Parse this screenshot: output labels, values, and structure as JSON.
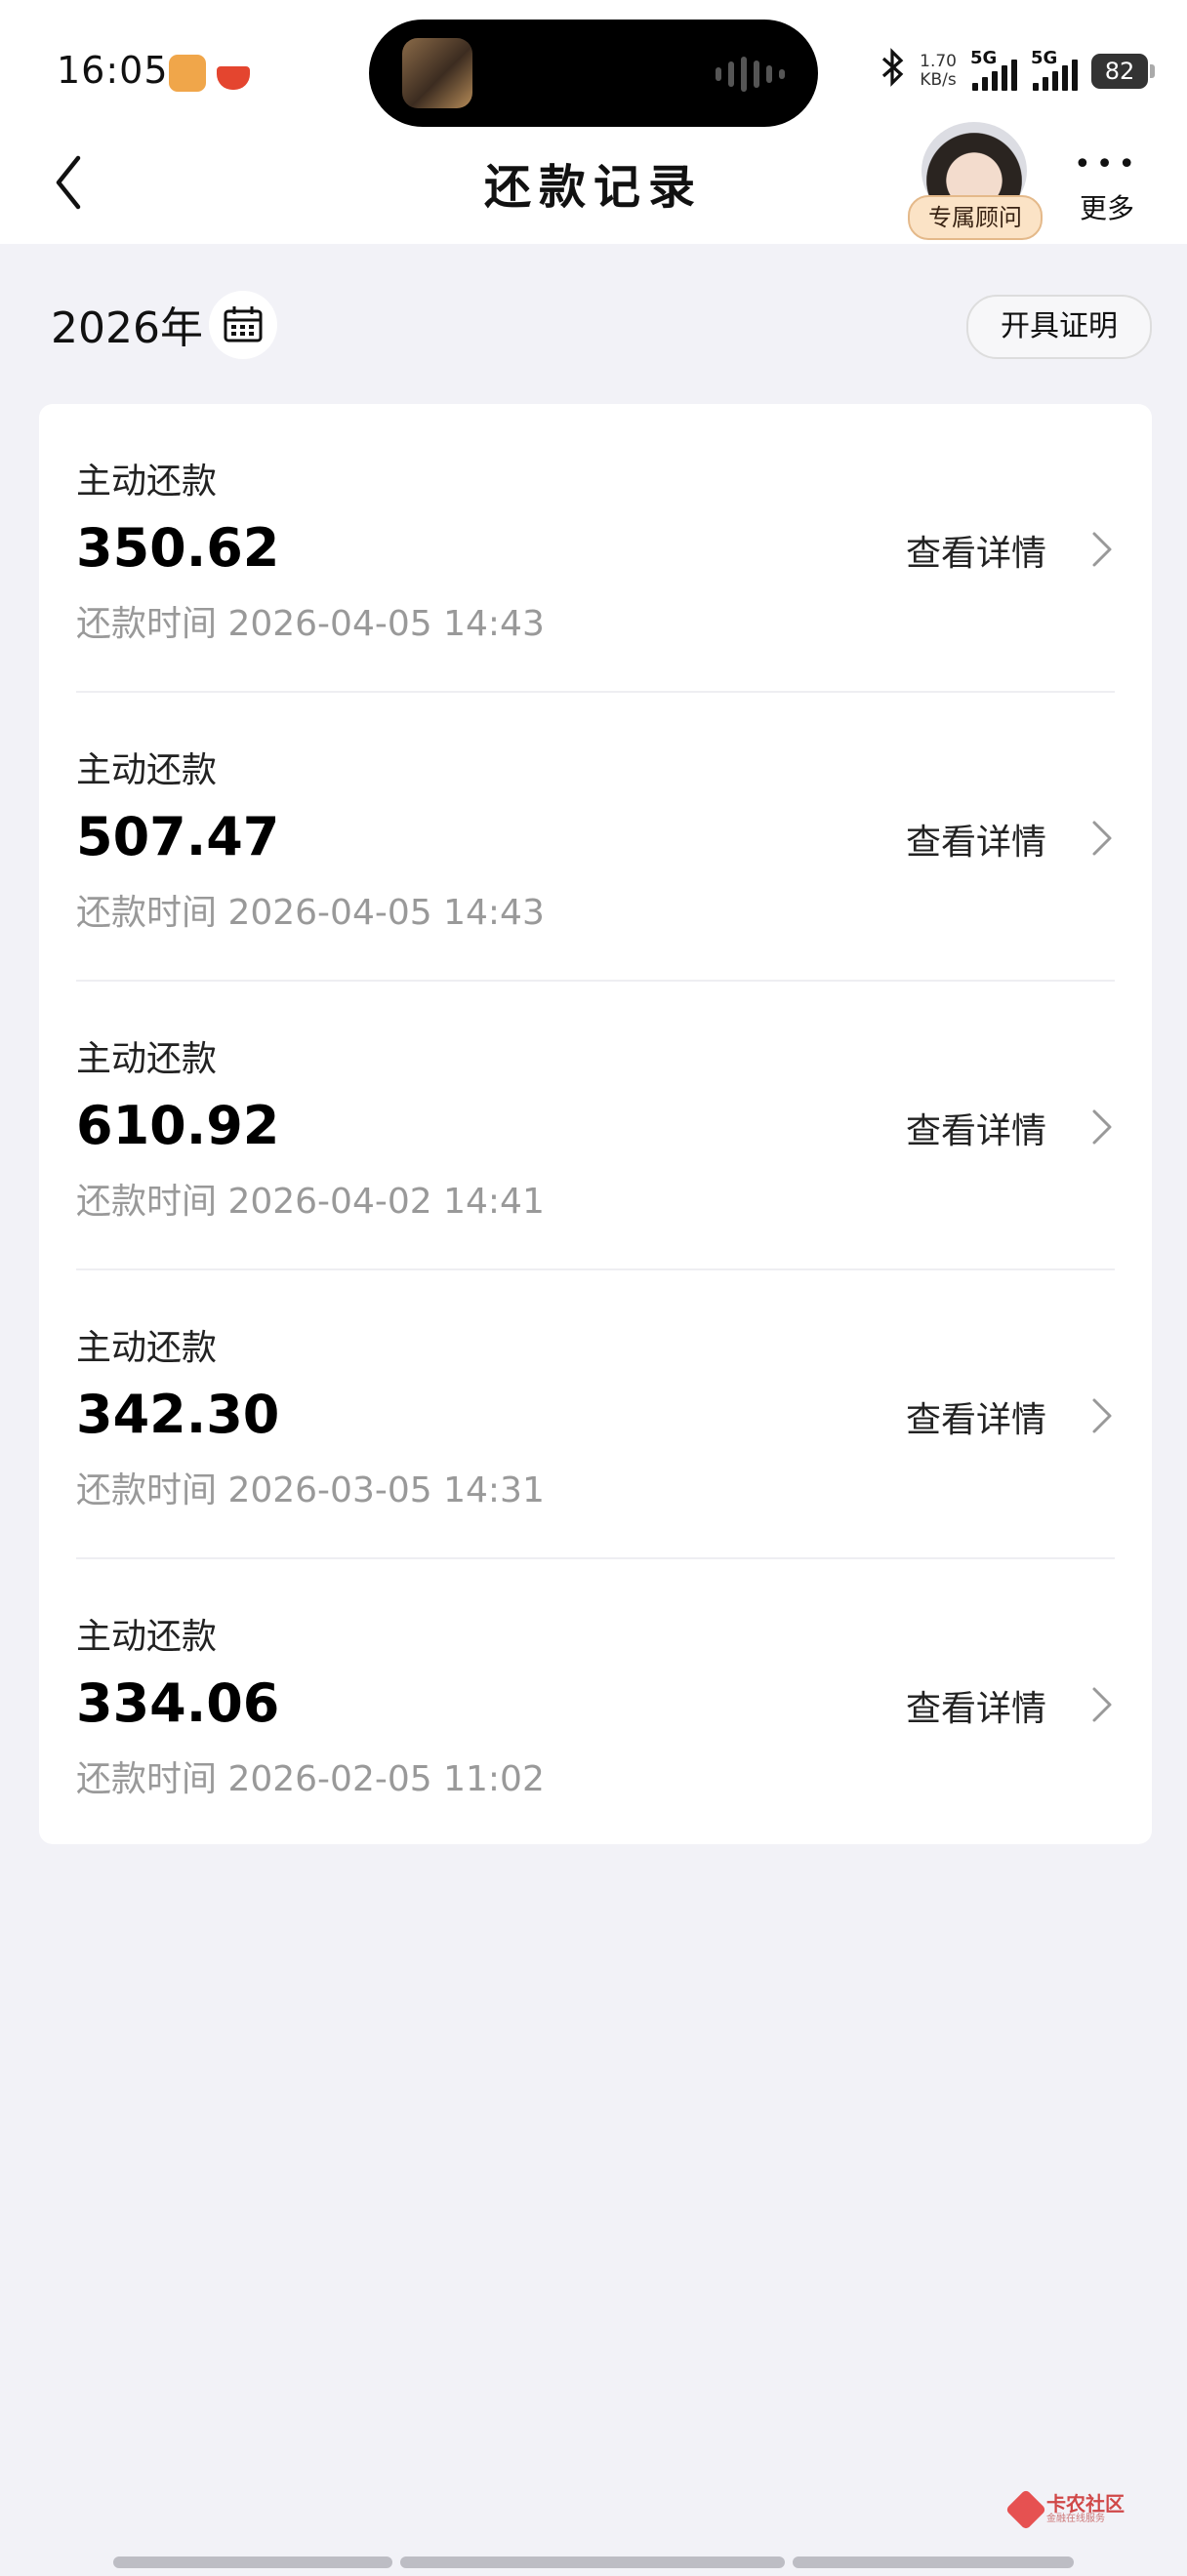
{
  "status_bar": {
    "time": "16:05",
    "net_speed_value": "1.70",
    "net_speed_unit": "KB/s",
    "signal_1": "5G",
    "signal_2": "5G",
    "battery": "82"
  },
  "nav": {
    "title": "还款记录",
    "advisor_label": "专属顾问",
    "more_label": "更多"
  },
  "filter": {
    "year": "2026年",
    "certificate_button": "开具证明"
  },
  "records": [
    {
      "type": "主动还款",
      "amount": "350.62",
      "time": "还款时间 2026-04-05 14:43",
      "detail": "查看详情"
    },
    {
      "type": "主动还款",
      "amount": "507.47",
      "time": "还款时间 2026-04-05 14:43",
      "detail": "查看详情"
    },
    {
      "type": "主动还款",
      "amount": "610.92",
      "time": "还款时间 2026-04-02 14:41",
      "detail": "查看详情"
    },
    {
      "type": "主动还款",
      "amount": "342.30",
      "time": "还款时间 2026-03-05 14:31",
      "detail": "查看详情"
    },
    {
      "type": "主动还款",
      "amount": "334.06",
      "time": "还款时间 2026-02-05 11:02",
      "detail": "查看详情"
    }
  ],
  "watermark": {
    "title": "卡农社区",
    "subtitle": "金融在线服务"
  },
  "icons": {
    "back": "chevron-left-icon",
    "calendar": "calendar-icon",
    "row_arrow": "chevron-right-icon",
    "bluetooth": "bluetooth-icon"
  },
  "colors": {
    "page_bg": "#f2f2f7",
    "card_bg": "#ffffff",
    "muted_text": "#999999",
    "advisor_tag_bg": "#fbe3c6"
  }
}
